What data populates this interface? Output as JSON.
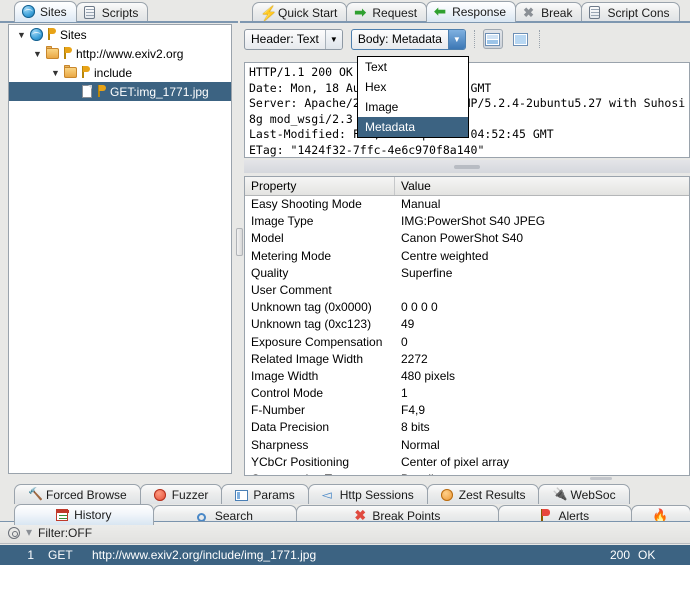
{
  "left_panel": {
    "tabs": [
      {
        "label": "Sites",
        "icon": "globe-icon",
        "active": true
      },
      {
        "label": "Scripts",
        "icon": "scroll-icon",
        "active": false
      }
    ],
    "tree": [
      {
        "label": "Sites",
        "icon": "globe-icon",
        "indent": 0,
        "twisty": "▼",
        "selected": false,
        "flag": true
      },
      {
        "label": "http://www.exiv2.org",
        "icon": "folder-icon",
        "indent": 1,
        "twisty": "▼",
        "selected": false,
        "flag": true
      },
      {
        "label": "include",
        "icon": "folder-icon",
        "indent": 2,
        "twisty": "▼",
        "selected": false,
        "flag": true
      },
      {
        "label": "GET:img_1771.jpg",
        "icon": "document-icon",
        "indent": 3,
        "twisty": "",
        "selected": true,
        "flag": true
      }
    ]
  },
  "right_panel": {
    "tabs": [
      {
        "label": "Quick Start",
        "icon": "lightning-icon",
        "active": false
      },
      {
        "label": "Request",
        "icon": "arrow-right-icon",
        "active": false
      },
      {
        "label": "Response",
        "icon": "arrow-left-icon",
        "active": true
      },
      {
        "label": "Break",
        "icon": "x-icon",
        "active": false
      },
      {
        "label": "Script Cons",
        "icon": "scroll-icon",
        "active": false
      }
    ],
    "toolbar": {
      "header_combo": "Header: Text",
      "body_combo": "Body: Metadata",
      "arrow_glyph": "▼",
      "view_split_horizontal": "split-horizontal-view-button",
      "view_single": "single-view-button"
    },
    "dropdown": {
      "open": true,
      "items": [
        "Text",
        "Hex",
        "Image",
        "Metadata"
      ],
      "selected": "Metadata"
    },
    "header_text": "HTTP/1.1 200 OK\nDate: Mon, 18 Aug 2014 19:22:41 GMT\nServer: Apache/2.2.8 (Ubuntu) PHP/5.2.4-2ubuntu5.27 with Suhosi\n8g mod_wsgi/2.3 Python/2.5.2\nLast-Modified: Fri, 20 Sep 2013 04:52:45 GMT\nETag: \"1424f32-7ffc-4e6c970f8a140\"",
    "metadata_table": {
      "columns": [
        "Property",
        "Value"
      ],
      "rows": [
        {
          "property": "Easy Shooting Mode",
          "value": "Manual"
        },
        {
          "property": "Image Type",
          "value": "IMG:PowerShot S40 JPEG"
        },
        {
          "property": "Model",
          "value": "Canon PowerShot S40"
        },
        {
          "property": "Metering Mode",
          "value": "Centre weighted"
        },
        {
          "property": "Quality",
          "value": "Superfine"
        },
        {
          "property": "User Comment",
          "value": ""
        },
        {
          "property": "Unknown tag (0x0000)",
          "value": "0 0 0 0"
        },
        {
          "property": "Unknown tag (0xc123)",
          "value": "49"
        },
        {
          "property": "Exposure Compensation",
          "value": "0"
        },
        {
          "property": "Related Image Width",
          "value": "2272"
        },
        {
          "property": "Image Width",
          "value": "480 pixels"
        },
        {
          "property": "Control Mode",
          "value": "1"
        },
        {
          "property": "F-Number",
          "value": "F4,9"
        },
        {
          "property": "Data Precision",
          "value": "8 bits"
        },
        {
          "property": "Sharpness",
          "value": "Normal"
        },
        {
          "property": "YCbCr Positioning",
          "value": "Center of pixel array"
        },
        {
          "property": "Compression Type",
          "value": "Baseline"
        }
      ]
    }
  },
  "bottom_panel": {
    "tabs_row1": [
      {
        "label": "Forced Browse",
        "icon": "hammer-icon",
        "active": false
      },
      {
        "label": "Fuzzer",
        "icon": "fuzzer-icon",
        "active": false
      },
      {
        "label": "Params",
        "icon": "params-icon",
        "active": false
      },
      {
        "label": "Http Sessions",
        "icon": "sessions-icon",
        "active": false
      },
      {
        "label": "Zest Results",
        "icon": "zest-icon",
        "active": false
      },
      {
        "label": "WebSoc",
        "icon": "plug-icon",
        "active": false
      }
    ],
    "tabs_row2": [
      {
        "label": "History",
        "icon": "calendar-icon",
        "active": true
      },
      {
        "label": "Search",
        "icon": "magnifier-icon",
        "active": false
      },
      {
        "label": "Break Points",
        "icon": "x-red-icon",
        "active": false
      },
      {
        "label": "Alerts",
        "icon": "flag-red-icon",
        "active": false
      },
      {
        "label": "",
        "icon": "flame-icon",
        "active": false
      }
    ],
    "filter_bar": {
      "target_icon": "target-icon",
      "funnel_icon": "funnel-icon",
      "label": "Filter:OFF"
    },
    "history_table": {
      "rows": [
        {
          "id": "1",
          "method": "GET",
          "url": "http://www.exiv2.org/include/img_1771.jpg",
          "code": "200",
          "reason": "OK",
          "selected": true
        }
      ]
    }
  },
  "colors": {
    "selection": "#3c6382",
    "tab_active": "#d9e6f2",
    "panel_bg": "#e8e8e6",
    "border": "#9aa3ac"
  }
}
